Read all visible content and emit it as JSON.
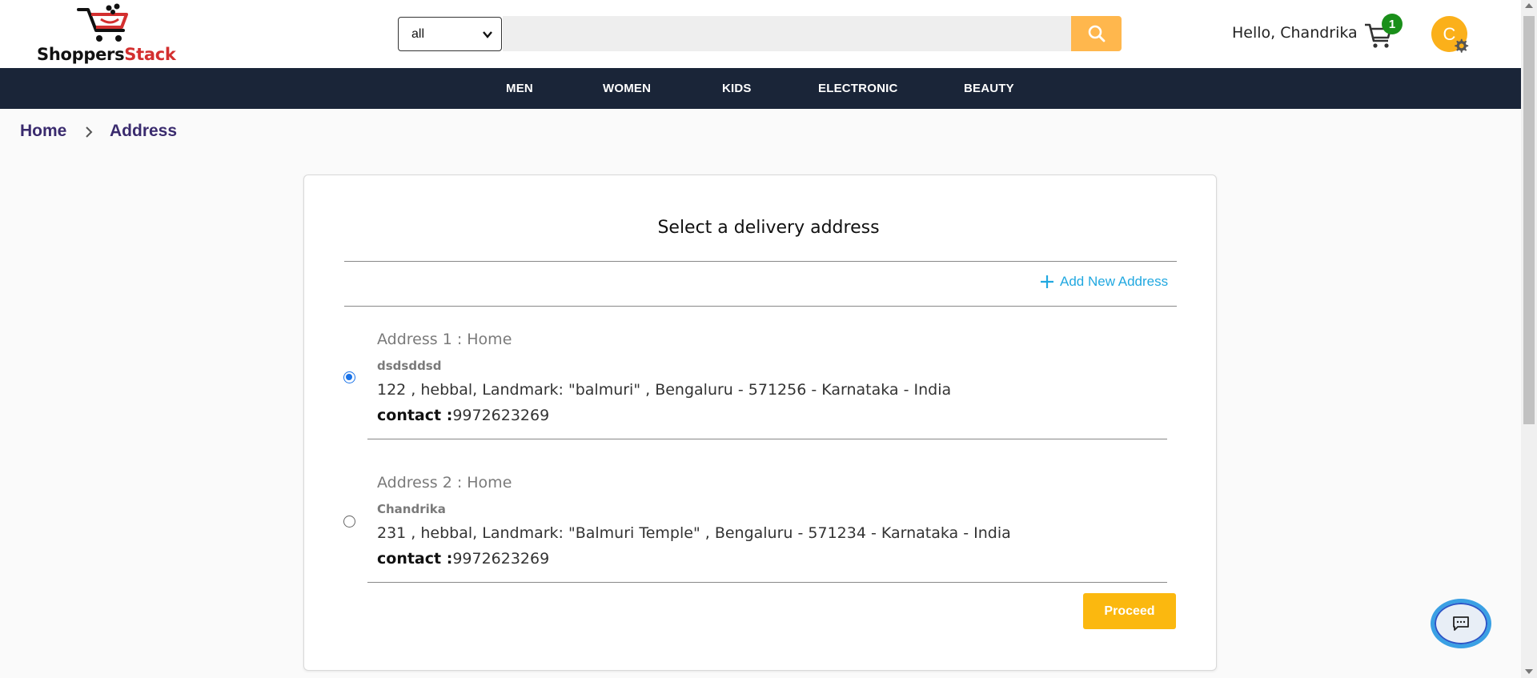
{
  "header": {
    "logo": {
      "part1": "Shoppers",
      "part2": "Stack"
    },
    "search": {
      "category": "all",
      "placeholder": ""
    },
    "greeting": "Hello, Chandrika",
    "cart_count": "1",
    "avatar_letter": "C"
  },
  "nav": {
    "items": [
      {
        "label": "MEN"
      },
      {
        "label": "WOMEN"
      },
      {
        "label": "KIDS"
      },
      {
        "label": "ELECTRONIC"
      },
      {
        "label": "BEAUTY"
      }
    ]
  },
  "breadcrumb": {
    "home": "Home",
    "current": "Address"
  },
  "main": {
    "title": "Select a delivery address",
    "add_new": "Add New Address",
    "addresses": [
      {
        "heading": "Address 1 :   Home",
        "name": "dsdsddsd",
        "line": "122 , hebbal, Landmark: \"balmuri\" , Bengaluru - 571256 - Karnataka - India",
        "contact_label": "contact :",
        "contact": "9972623269",
        "selected": true
      },
      {
        "heading": "Address 2 :   Home",
        "name": "Chandrika",
        "line": "231 , hebbal, Landmark: \"Balmuri Temple\" , Bengaluru - 571234 - Karnataka - India",
        "contact_label": "contact :",
        "contact": "9972623269",
        "selected": false
      }
    ],
    "proceed_label": "Proceed"
  },
  "colors": {
    "nav_bg": "#1a2538",
    "accent": "#fbb80f",
    "search_button": "#ffb74d",
    "link": "#21a8e0",
    "breadcrumb": "#3a2b6e",
    "cart_badge": "#1a8f1a"
  },
  "icons": {
    "logo": "cart-logo-icon",
    "search": "search-icon",
    "cart": "cart-icon",
    "settings": "gear-icon",
    "add": "plus-icon",
    "chat": "chat-icon",
    "breadcrumb_sep": "chevron-right-icon",
    "select": "chevron-down-icon"
  }
}
